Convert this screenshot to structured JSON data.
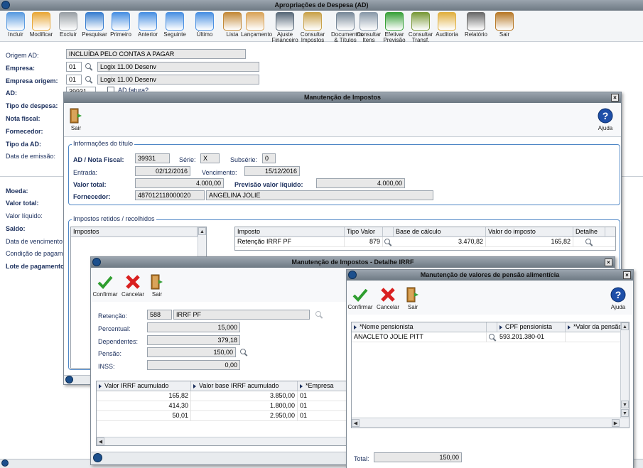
{
  "main": {
    "title": "Apropriações de Despesa (AD)",
    "toolbar": [
      {
        "label": "Incluir",
        "icon": "include-icon"
      },
      {
        "label": "Modificar",
        "icon": "modify-icon"
      },
      {
        "label": "Excluir",
        "icon": "trash-icon"
      },
      {
        "label": "Pesquisar",
        "icon": "search-icon"
      },
      {
        "label": "Primeiro",
        "icon": "first-icon"
      },
      {
        "label": "Anterior",
        "icon": "previous-icon"
      },
      {
        "label": "Seguinte",
        "icon": "next-icon"
      },
      {
        "label": "Último",
        "icon": "last-icon"
      },
      {
        "label": "Lista",
        "icon": "list-icon"
      },
      {
        "label": "Lançamento",
        "icon": "posting-icon"
      },
      {
        "label": "Ajuste Financeiro",
        "icon": "financial-adjust-icon"
      },
      {
        "label": "Consultar Impostos",
        "icon": "taxes-icon"
      },
      {
        "label": "Documentos & Títulos",
        "icon": "documents-icon"
      },
      {
        "label": "Consultar Itens",
        "icon": "items-icon"
      },
      {
        "label": "Efetivar Previsão",
        "icon": "forecast-icon"
      },
      {
        "label": "Consultar Transf.",
        "icon": "transfer-icon"
      },
      {
        "label": "Auditoria",
        "icon": "audit-icon"
      },
      {
        "label": "Relatório",
        "icon": "report-icon"
      },
      {
        "label": "Sair",
        "icon": "exit-icon"
      }
    ],
    "labels": {
      "origem_ad": "Origem AD:",
      "empresa": "Empresa:",
      "empresa_origem": "Empresa origem:",
      "ad": "AD:",
      "tipo_despesa": "Tipo de despesa:",
      "nota_fiscal": "Nota fiscal:",
      "fornecedor": "Fornecedor:",
      "tipo_ad": "Tipo da AD:",
      "data_emissao": "Data de emissão:",
      "moeda": "Moeda:",
      "valor_total": "Valor total:",
      "valor_liquido": "Valor líquido:",
      "saldo": "Saldo:",
      "data_vencimento": "Data de vencimento:",
      "condicao_pagamento": "Condição de pagamen",
      "lote_pagamento": "Lote de pagamento:"
    },
    "values": {
      "origem_ad": "INCLUÍDA PELO CONTAS A PAGAR",
      "empresa_code": "01",
      "empresa_name": "Logix 11.00 Desenv",
      "empresa_origem_code": "01",
      "empresa_origem_name": "Logix 11.00 Desenv",
      "ad": "39931",
      "ad_fatura": "AD fatura?"
    }
  },
  "impostos": {
    "title": "Manutenção de Impostos",
    "sair": "Sair",
    "ajuda": "Ajuda",
    "info_title": "Informações do título",
    "ad_nf_label": "AD / Nota Fiscal:",
    "ad_nf": "39931",
    "serie_label": "Série:",
    "serie": "X",
    "subserie_label": "Subsérie:",
    "subserie": "0",
    "entrada_label": "Entrada:",
    "entrada": "02/12/2016",
    "vencimento_label": "Vencimento:",
    "vencimento": "15/12/2016",
    "valor_total_label": "Valor total:",
    "valor_total": "4.000,00",
    "previsao_label": "Previsão valor líquido:",
    "previsao": "4.000,00",
    "fornecedor_label": "Fornecedor:",
    "fornecedor_code": "487012118000020",
    "fornecedor_name": "ANGELINA JOLIE",
    "retidos_title": "Impostos retidos / recolhidos",
    "list_header": "Impostos",
    "grid_headers": [
      "Imposto",
      "Tipo Valor",
      "Base de cálculo",
      "Valor do imposto",
      "Detalhe"
    ],
    "grid_row": {
      "imposto": "Retenção IRRF PF",
      "tipo": "879",
      "base": "3.470,82",
      "valor": "165,82"
    }
  },
  "detalhe": {
    "title": "Manutenção de Impostos - Detalhe IRRF",
    "confirmar": "Confirmar",
    "cancelar": "Cancelar",
    "sair": "Sair",
    "retencao_label": "Retenção:",
    "retencao_code": "588",
    "retencao_name": "IRRF PF",
    "percentual_label": "Percentual:",
    "percentual": "15,000",
    "dependentes_label": "Dependentes:",
    "dependentes": "379,18",
    "pensao_label": "Pensão:",
    "pensao": "150,00",
    "inss_label": "INSS:",
    "inss": "0,00",
    "grid_headers": [
      "Valor IRRF acumulado",
      "Valor base IRRF acumulado",
      "*Empresa"
    ],
    "rows": [
      {
        "v": "165,82",
        "b": "3.850,00",
        "e": "01"
      },
      {
        "v": "414,30",
        "b": "1.800,00",
        "e": "01"
      },
      {
        "v": "50,01",
        "b": "2.950,00",
        "e": "01"
      }
    ]
  },
  "pensao": {
    "title": "Manutenção de valores de pensão alimentícia",
    "confirmar": "Confirmar",
    "cancelar": "Cancelar",
    "sair": "Sair",
    "ajuda": "Ajuda",
    "grid_headers": [
      "*Nome pensionista",
      "CPF pensionista",
      "*Valor da pensão"
    ],
    "row": {
      "nome": "ANACLETO JOLIE PITT",
      "cpf": "593.201.380-01"
    },
    "total_label": "Total:",
    "total": "150,00"
  }
}
